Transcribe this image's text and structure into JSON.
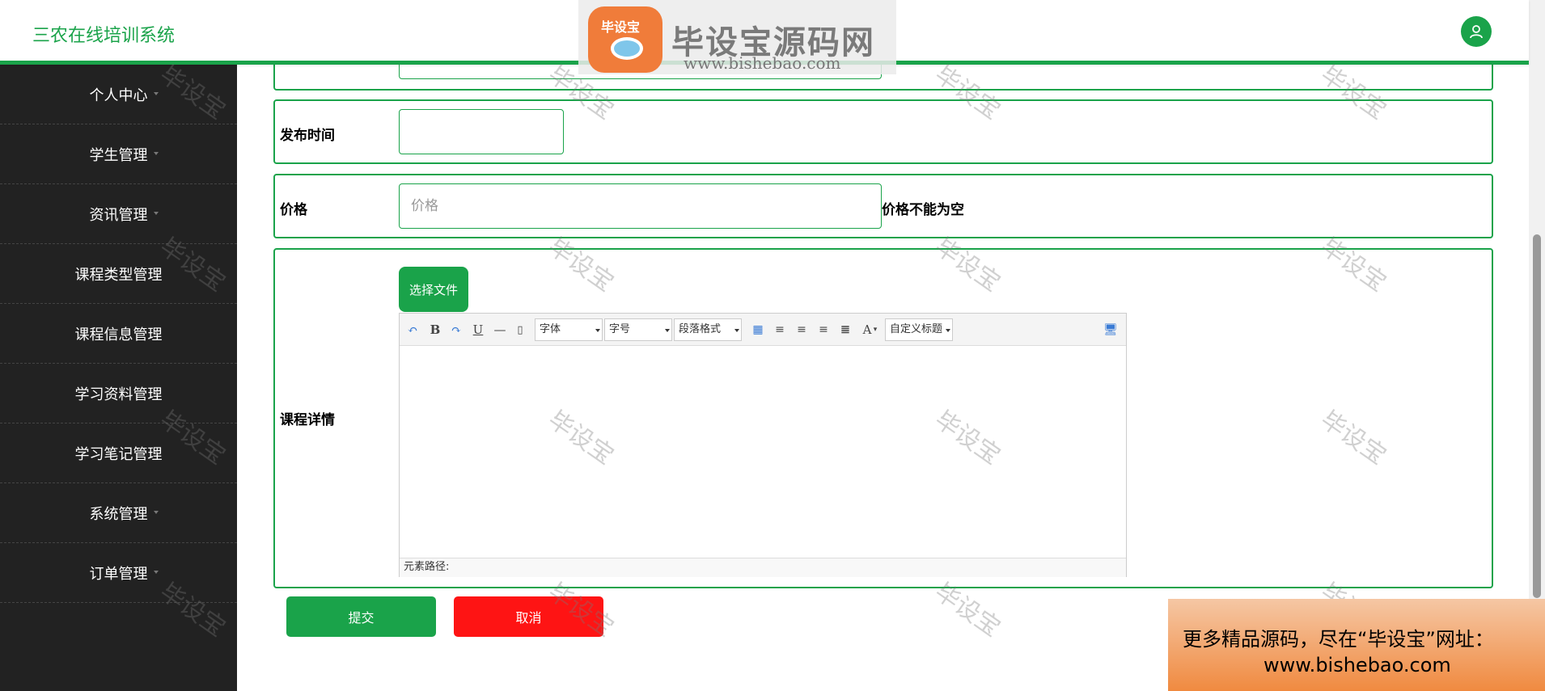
{
  "header": {
    "title": "三农在线培训系统"
  },
  "sidebar": {
    "items": [
      {
        "label": "个人中心"
      },
      {
        "label": "学生管理"
      },
      {
        "label": "资讯管理"
      },
      {
        "label": "课程类型管理"
      },
      {
        "label": "课程信息管理"
      },
      {
        "label": "学习资料管理"
      },
      {
        "label": "学习笔记管理"
      },
      {
        "label": "系统管理"
      },
      {
        "label": "订单管理"
      }
    ]
  },
  "form": {
    "publish_time": {
      "label": "发布时间",
      "value": ""
    },
    "price": {
      "label": "价格",
      "placeholder": "价格",
      "error": "价格不能为空"
    },
    "course_detail": {
      "label": "课程详情",
      "file_button": "选择文件"
    }
  },
  "editor": {
    "font_select": "字体",
    "size_select": "字号",
    "paragraph_select": "段落格式",
    "custom_title_select": "自定义标题",
    "status_path": "元素路径:"
  },
  "actions": {
    "submit": "提交",
    "cancel": "取消"
  },
  "watermarks": {
    "logo_badge": "毕设宝",
    "logo_title": "毕设宝源码网",
    "logo_url": "www.bishebao.com",
    "tile": "毕设宝",
    "promo_line1": "更多精品源码，尽在“毕设宝”网址：",
    "promo_line2": "www.bishebao.com"
  },
  "colors": {
    "accent": "#1aa34a",
    "danger": "#fe1414",
    "sidebar": "#222222"
  }
}
